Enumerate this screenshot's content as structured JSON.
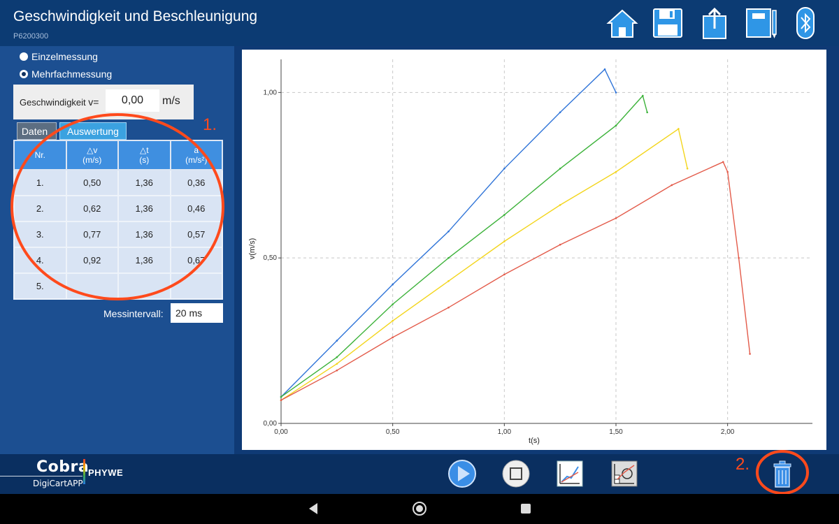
{
  "header": {
    "title": "Geschwindigkeit und Beschleunigung",
    "code": "P6200300",
    "icons": [
      "home-icon",
      "save-icon",
      "share-icon",
      "notebook-icon",
      "bluetooth-icon"
    ]
  },
  "mode": {
    "single": "Einzelmessung",
    "multi": "Mehrfachmessung",
    "selected": "multi"
  },
  "speed": {
    "label": "Geschwindigkeit",
    "symbol": "v=",
    "value": "0,00",
    "unit": "m/s"
  },
  "tabs": [
    {
      "label": "Daten"
    },
    {
      "label": "Auswertung"
    }
  ],
  "table": {
    "headers": [
      {
        "top": "Nr.",
        "bottom": ""
      },
      {
        "top": "△v",
        "bottom": "(m/s)"
      },
      {
        "top": "△t",
        "bottom": "(s)"
      },
      {
        "top": "a",
        "bottom": "(m/s²)"
      }
    ],
    "rows": [
      [
        "1.",
        "0,50",
        "1,36",
        "0,36"
      ],
      [
        "2.",
        "0,62",
        "1,36",
        "0,46"
      ],
      [
        "3.",
        "0,77",
        "1,36",
        "0,57"
      ],
      [
        "4.",
        "0,92",
        "1,36",
        "0,67"
      ],
      [
        "5.",
        "",
        "",
        ""
      ]
    ]
  },
  "interval": {
    "label": "Messintervall:",
    "value": "20 ms"
  },
  "annotations": {
    "one": "1.",
    "two": "2.",
    "color": "#ff4a1c"
  },
  "bottom_bar": {
    "brand": "Cobra",
    "app": "DigiCartAPP",
    "vendor": "PHYWE",
    "icons": [
      "play-icon",
      "stop-icon",
      "graph-icon",
      "analysis-icon",
      "trash-icon"
    ]
  },
  "nav": {
    "icons": [
      "back-icon",
      "home-circle-icon",
      "recents-icon"
    ]
  },
  "chart_data": {
    "type": "line",
    "xlabel": "t(s)",
    "ylabel": "v(m/s)",
    "xlim": [
      0,
      2.38
    ],
    "ylim": [
      0,
      1.1
    ],
    "xticks": [
      0,
      0.5,
      1.0,
      1.5,
      2.0
    ],
    "xtick_labels": [
      "0,00",
      "0,50",
      "1,00",
      "1,50",
      "2,00"
    ],
    "yticks": [
      0,
      0.5,
      1.0
    ],
    "ytick_labels": [
      "0,00",
      "0,50",
      "1,00"
    ],
    "grid": true,
    "series": [
      {
        "color": "#2f74d8",
        "x": [
          0,
          0.25,
          0.5,
          0.75,
          1.0,
          1.25,
          1.45,
          1.5
        ],
        "y": [
          0.08,
          0.25,
          0.42,
          0.58,
          0.77,
          0.94,
          1.07,
          1.0
        ]
      },
      {
        "color": "#3cb23a",
        "x": [
          0,
          0.25,
          0.5,
          0.75,
          1.0,
          1.25,
          1.5,
          1.62,
          1.64
        ],
        "y": [
          0.08,
          0.2,
          0.36,
          0.5,
          0.63,
          0.77,
          0.9,
          0.99,
          0.94
        ]
      },
      {
        "color": "#f3d51c",
        "x": [
          0,
          0.25,
          0.5,
          0.75,
          1.0,
          1.25,
          1.5,
          1.78,
          1.82
        ],
        "y": [
          0.07,
          0.18,
          0.31,
          0.43,
          0.55,
          0.66,
          0.76,
          0.89,
          0.77
        ]
      },
      {
        "color": "#e35b4a",
        "x": [
          0,
          0.25,
          0.5,
          0.75,
          1.0,
          1.25,
          1.5,
          1.75,
          1.98,
          2.0,
          2.05,
          2.1
        ],
        "y": [
          0.07,
          0.16,
          0.26,
          0.35,
          0.45,
          0.54,
          0.62,
          0.72,
          0.79,
          0.76,
          0.5,
          0.21
        ]
      }
    ]
  }
}
